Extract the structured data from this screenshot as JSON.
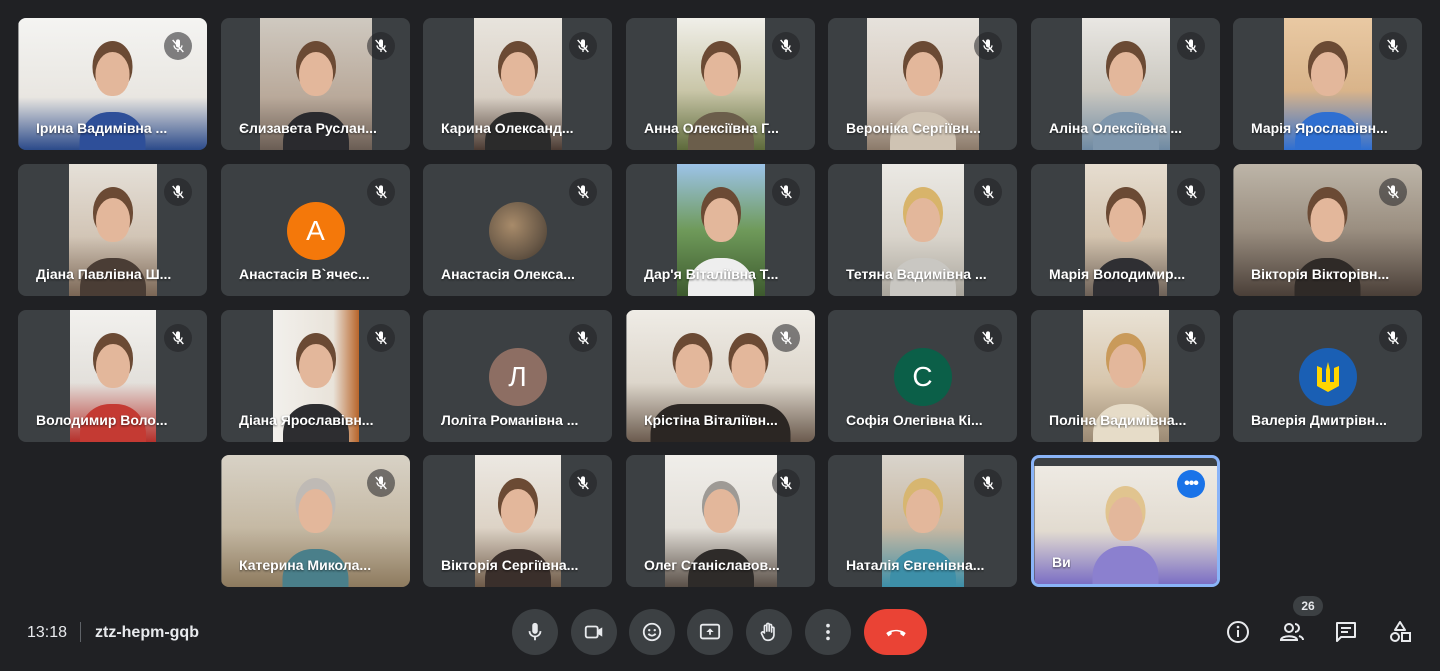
{
  "participants": [
    {
      "name": "Ірина Вадимівна ..."
    },
    {
      "name": "Єлизавета Руслан..."
    },
    {
      "name": "Карина Олександ..."
    },
    {
      "name": "Анна Олексіївна Г..."
    },
    {
      "name": "Вероніка Сергіївн..."
    },
    {
      "name": "Аліна Олексіївна ..."
    },
    {
      "name": "Марія Ярославівн..."
    },
    {
      "name": "Діана Павлівна Ш..."
    },
    {
      "name": "Анастасія В`ячес...",
      "initial": "А",
      "avatar_color": "#f4780a"
    },
    {
      "name": "Анастасія Олекса..."
    },
    {
      "name": "Дар'я Віталіївна Т..."
    },
    {
      "name": "Тетяна Вадимівна ..."
    },
    {
      "name": "Марія Володимир..."
    },
    {
      "name": "Вікторія Вікторівн..."
    },
    {
      "name": "Володимир Воло..."
    },
    {
      "name": "Діана Ярославівн..."
    },
    {
      "name": "Лоліта Романівна ...",
      "initial": "Л",
      "avatar_color": "#8d6e63"
    },
    {
      "name": "Крістіна Віталіївн..."
    },
    {
      "name": "Софія Олегівна Кі...",
      "initial": "С",
      "avatar_color": "#0b5f48"
    },
    {
      "name": "Поліна Вадимівна..."
    },
    {
      "name": "Валерія Дмитрівн...",
      "avatar_color": "#1a5fb4"
    },
    {
      "name": "Катерина Микола..."
    },
    {
      "name": "Вікторія Сергіївна..."
    },
    {
      "name": "Олег Станіславов..."
    },
    {
      "name": "Наталія Євгенівна..."
    }
  ],
  "self_tile": {
    "name": "Ви",
    "more_icon": "more-horiz-icon"
  },
  "bottom_bar": {
    "time": "13:18",
    "meeting_code": "ztz-hepm-gqb",
    "people_count": "26"
  },
  "colors": {
    "background": "#202124",
    "tile": "#3c4043",
    "hangup": "#ea4335",
    "accent": "#1a73e8",
    "self_border": "#8ab4f8"
  }
}
